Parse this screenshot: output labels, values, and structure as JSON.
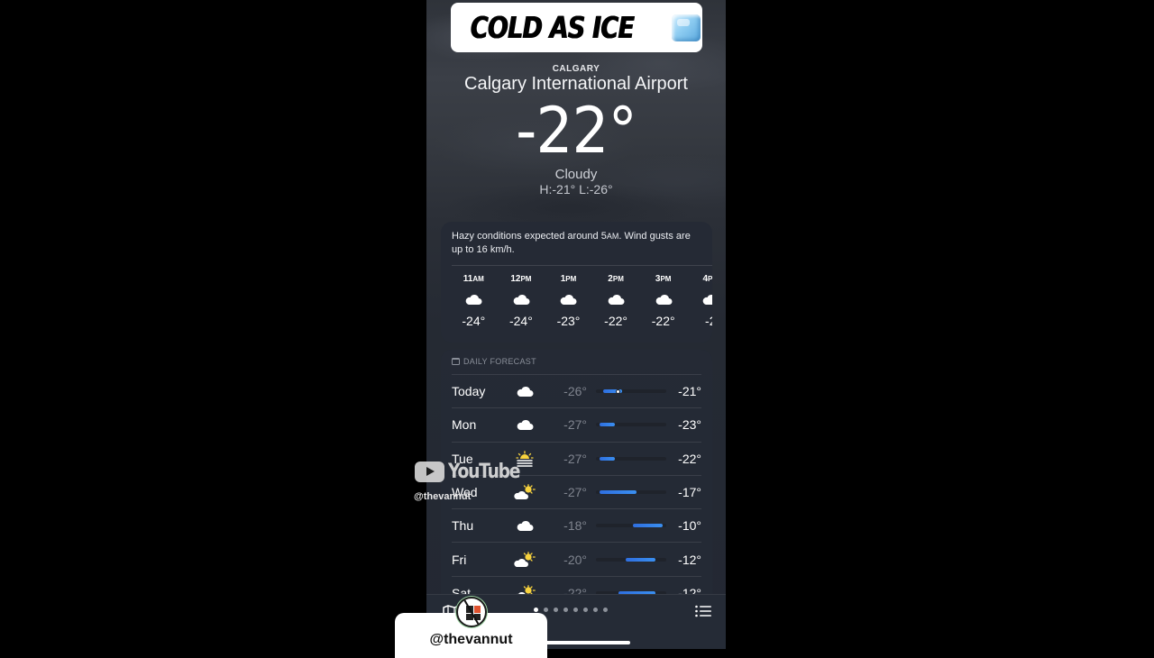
{
  "banner": {
    "text": "COLD AS ICE",
    "emoji": "ice-cube"
  },
  "header": {
    "city": "CALGARY",
    "location": "Calgary International Airport",
    "temperature": "-22°",
    "condition": "Cloudy",
    "high_low": "H:-21°  L:-26°"
  },
  "hourly": {
    "summary_before": "Hazy conditions expected around 5",
    "summary_ampm": "AM",
    "summary_after": ". Wind gusts are up to 16 km/h.",
    "hours": [
      {
        "hour": "11",
        "ampm": "AM",
        "icon": "cloud",
        "temp": "-24°"
      },
      {
        "hour": "12",
        "ampm": "PM",
        "icon": "cloud",
        "temp": "-24°"
      },
      {
        "hour": "1",
        "ampm": "PM",
        "icon": "cloud",
        "temp": "-23°"
      },
      {
        "hour": "2",
        "ampm": "PM",
        "icon": "cloud",
        "temp": "-22°"
      },
      {
        "hour": "3",
        "ampm": "PM",
        "icon": "cloud",
        "temp": "-22°"
      },
      {
        "hour": "4",
        "ampm": "PM",
        "icon": "cloud",
        "temp": "-2"
      }
    ]
  },
  "daily": {
    "header": "DAILY FORECAST",
    "range_min": -28,
    "range_max": -9,
    "days": [
      {
        "day": "Today",
        "icon": "cloud",
        "low": "-26°",
        "high": "-21°",
        "low_val": -26,
        "high_val": -21,
        "current_val": -22
      },
      {
        "day": "Mon",
        "icon": "cloud",
        "low": "-27°",
        "high": "-23°",
        "low_val": -27,
        "high_val": -23
      },
      {
        "day": "Tue",
        "icon": "haze-sun",
        "low": "-27°",
        "high": "-22°",
        "low_val": -27,
        "high_val": -23
      },
      {
        "day": "Wed",
        "icon": "partly-sunny",
        "low": "-27°",
        "high": "-17°",
        "low_val": -27,
        "high_val": -17
      },
      {
        "day": "Thu",
        "icon": "cloud",
        "low": "-18°",
        "high": "-10°",
        "low_val": -18,
        "high_val": -10
      },
      {
        "day": "Fri",
        "icon": "partly-sunny",
        "low": "-20°",
        "high": "-12°",
        "low_val": -20,
        "high_val": -12
      },
      {
        "day": "Sat",
        "icon": "partly-sunny",
        "low": "-22°",
        "high": "-12°",
        "low_val": -22,
        "high_val": -12
      }
    ]
  },
  "bottom_bar": {
    "page_count": 8,
    "current_page": 1
  },
  "watermark": {
    "brand": "YouTube",
    "handle": "@thevannut"
  },
  "creator": {
    "handle": "@thevannut"
  }
}
